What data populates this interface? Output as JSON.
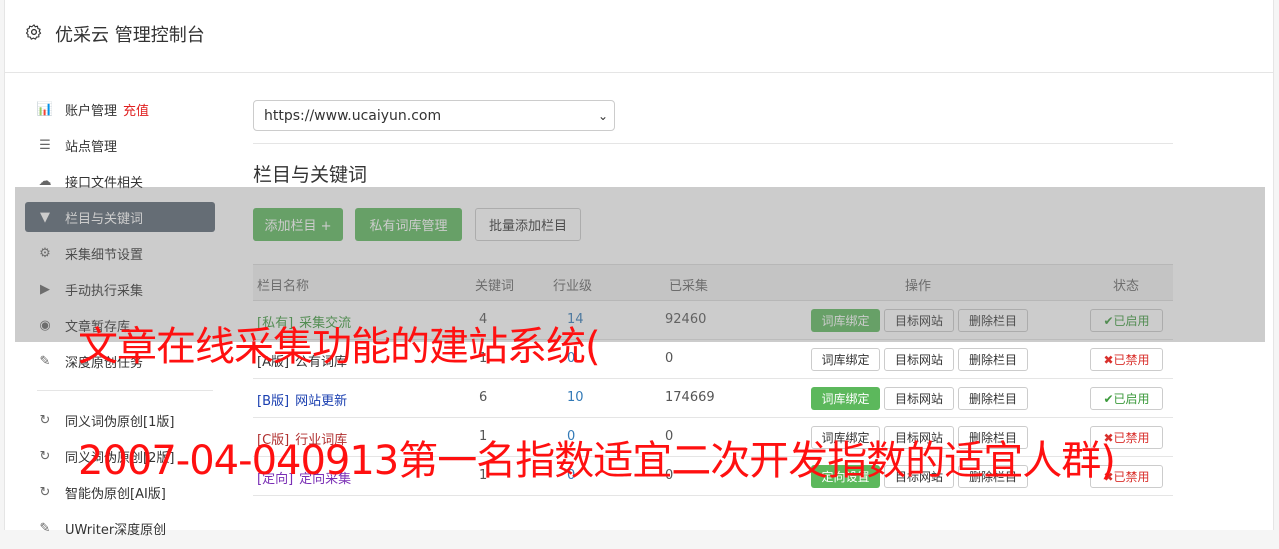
{
  "header": {
    "title": "优采云 管理控制台",
    "icon": "gear-icon"
  },
  "sidebar": {
    "items": [
      {
        "label": "账户管理",
        "extra": "充值",
        "icon": "bar-chart-icon",
        "glyph": "📊"
      },
      {
        "label": "站点管理",
        "icon": "server-icon",
        "glyph": "☰"
      },
      {
        "label": "接口文件相关",
        "icon": "cloud-upload-icon",
        "glyph": "☁"
      },
      {
        "label": "栏目与关键词",
        "icon": "filter-icon",
        "glyph": "▼",
        "active": true
      },
      {
        "label": "采集细节设置",
        "icon": "cogs-icon",
        "glyph": "⚙"
      },
      {
        "label": "手动执行采集",
        "icon": "play-icon",
        "glyph": "▶"
      },
      {
        "label": "文章暂存库",
        "icon": "database-icon",
        "glyph": "◉"
      },
      {
        "label": "深度原创任务",
        "icon": "edit-icon",
        "glyph": "✎"
      }
    ],
    "items2": [
      {
        "label": "同义词伪原创[1版]",
        "icon": "refresh-icon",
        "glyph": "↻"
      },
      {
        "label": "同义词伪原创[2版]",
        "icon": "refresh-icon",
        "glyph": "↻"
      },
      {
        "label": "智能伪原创[AI版]",
        "icon": "refresh-icon",
        "glyph": "↻"
      },
      {
        "label": "UWriter深度原创",
        "icon": "edit-icon",
        "glyph": "✎"
      }
    ]
  },
  "main": {
    "site_select": {
      "value": "https://www.ucaiyun.com"
    },
    "section_title": "栏目与关键词",
    "buttons": {
      "add_column": "添加栏目 +",
      "private_lib": "私有词库管理",
      "batch_add": "批量添加栏目"
    },
    "table": {
      "headers": [
        "栏目名称",
        "关键词",
        "行业级",
        "已采集",
        "操作",
        "状态"
      ],
      "rows": [
        {
          "tag": "[私有]",
          "name": "采集交流",
          "kw": "4",
          "level": "14",
          "collected": "92460",
          "op1": "词库绑定",
          "op1_green": true,
          "op2": "目标网站",
          "op3": "删除栏目",
          "status": "✔已启用",
          "ok": true,
          "color": "#3c9a3c"
        },
        {
          "tag": "[A版]",
          "name": "公有词库",
          "kw": "1",
          "level": "0",
          "collected": "0",
          "op1": "词库绑定",
          "op1_green": false,
          "op2": "目标网站",
          "op3": "删除栏目",
          "status": "✖已禁用",
          "ok": false,
          "color": "#333333"
        },
        {
          "tag": "[B版]",
          "name": "网站更新",
          "kw": "6",
          "level": "10",
          "collected": "174669",
          "op1": "词库绑定",
          "op1_green": true,
          "op2": "目标网站",
          "op3": "删除栏目",
          "status": "✔已启用",
          "ok": true,
          "color": "#1a3fb0"
        },
        {
          "tag": "[C版]",
          "name": "行业词库",
          "kw": "1",
          "level": "0",
          "collected": "0",
          "op1": "词库绑定",
          "op1_green": false,
          "op2": "目标网站",
          "op3": "删除栏目",
          "status": "✖已禁用",
          "ok": false,
          "color": "#b03030"
        },
        {
          "tag": "[定向]",
          "name": "定向采集",
          "kw": "1",
          "level": "0",
          "collected": "0",
          "op1": "定向设置",
          "op1_green": true,
          "op2": "目标网站",
          "op3": "删除栏目",
          "status": "✖已禁用",
          "ok": false,
          "color": "#7a2fb5"
        }
      ]
    }
  },
  "watermark": {
    "line1": "文章在线采集功能的建站系统(",
    "line2": "2007-04-040913第一名指数适宜二次开发指数的适宜人群)"
  }
}
